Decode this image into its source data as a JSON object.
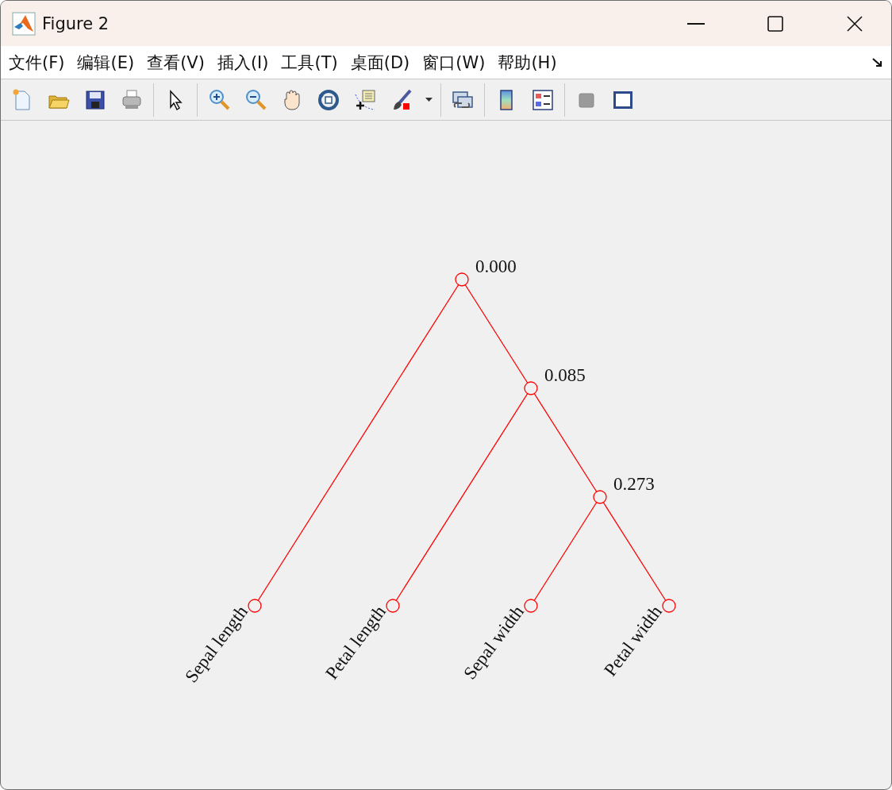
{
  "window": {
    "title": "Figure 2"
  },
  "menu": [
    {
      "label": "文件(F)"
    },
    {
      "label": "编辑(E)"
    },
    {
      "label": "查看(V)"
    },
    {
      "label": "插入(I)"
    },
    {
      "label": "工具(T)"
    },
    {
      "label": "桌面(D)"
    },
    {
      "label": "窗口(W)"
    },
    {
      "label": "帮助(H)"
    }
  ],
  "dendrogram": {
    "label": "0.000",
    "children": [
      {
        "label": "Sepal length"
      },
      {
        "label": "0.085",
        "children": [
          {
            "label": "Petal length"
          },
          {
            "label": "0.273",
            "children": [
              {
                "label": "Sepal width"
              },
              {
                "label": "Petal width"
              }
            ]
          }
        ]
      }
    ]
  }
}
